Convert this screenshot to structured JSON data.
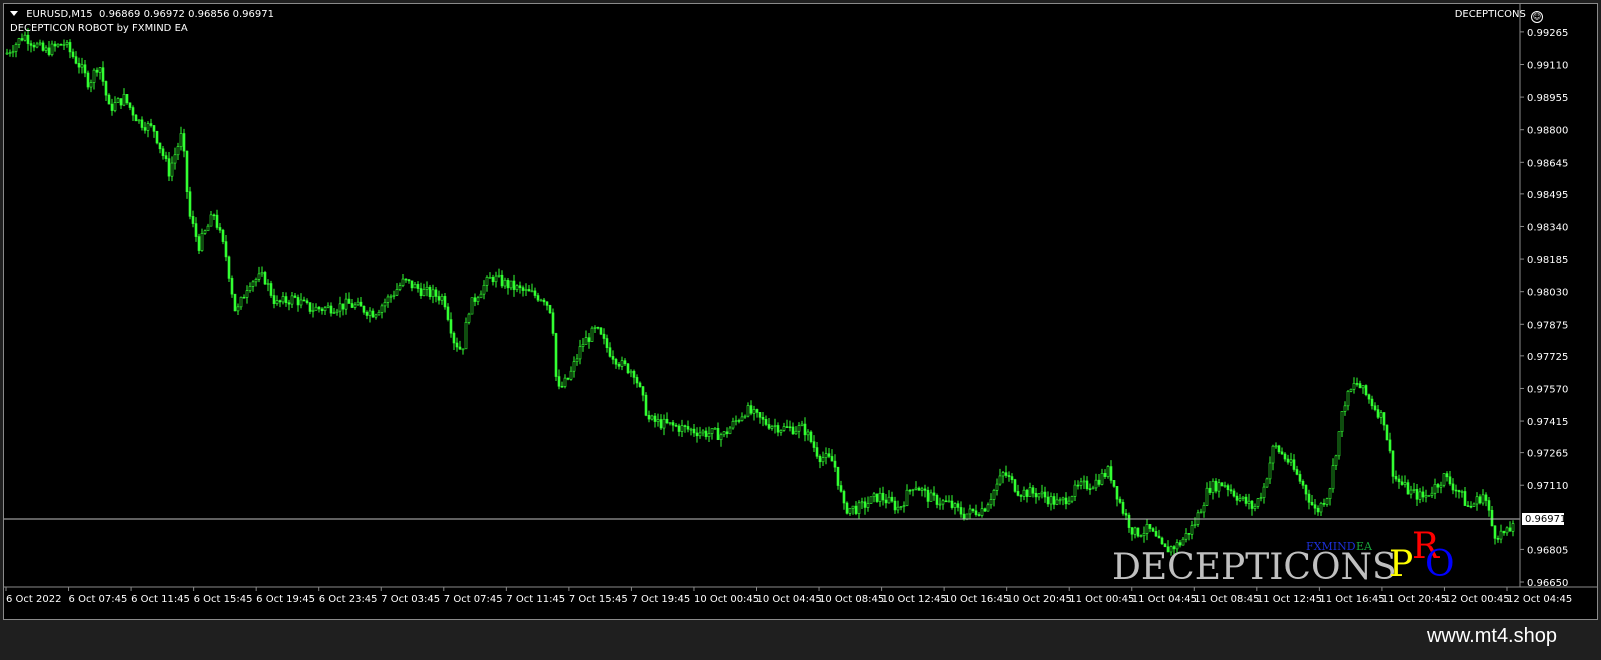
{
  "chart_header": {
    "symbol": "EURUSD,M15",
    "ohlc": "0.96869 0.96972 0.96856 0.96971",
    "robot": "DECEPTICON ROBOT by FXMIND EA",
    "corner_label": "DECEPTICONS"
  },
  "branding": {
    "decepticons": "DECEPTICONS",
    "fxmind": "FXMIND",
    "ea": "EA",
    "pro_p": "P",
    "pro_r": "R",
    "pro_o": "O",
    "watermark": "www.mt4.shop"
  },
  "colors": {
    "background": "#000000",
    "candles": "#32ff32",
    "axis_text": "#ffffff",
    "bid_line": "#c0c0c0"
  },
  "chart_data": {
    "type": "candlestick",
    "symbol": "EURUSD",
    "timeframe": "M15",
    "ylim": [
      0.9665,
      0.9935
    ],
    "y_ticks": [
      "0.99265",
      "0.99110",
      "0.98955",
      "0.98800",
      "0.98645",
      "0.98495",
      "0.98340",
      "0.98185",
      "0.98030",
      "0.97875",
      "0.97725",
      "0.97570",
      "0.97415",
      "0.97265",
      "0.97110",
      "0.96805",
      "0.96650"
    ],
    "x_ticks": [
      "6 Oct 2022",
      "6 Oct 07:45",
      "6 Oct 11:45",
      "6 Oct 15:45",
      "6 Oct 19:45",
      "6 Oct 23:45",
      "7 Oct 03:45",
      "7 Oct 07:45",
      "7 Oct 11:45",
      "7 Oct 15:45",
      "7 Oct 19:45",
      "10 Oct 00:45",
      "10 Oct 04:45",
      "10 Oct 08:45",
      "10 Oct 12:45",
      "10 Oct 16:45",
      "10 Oct 20:45",
      "11 Oct 00:45",
      "11 Oct 04:45",
      "11 Oct 08:45",
      "11 Oct 12:45",
      "11 Oct 16:45",
      "11 Oct 20:45",
      "12 Oct 00:45",
      "12 Oct 04:45"
    ],
    "current_price": "0.96971",
    "close_path": [
      [
        0,
        0.9915
      ],
      [
        20,
        0.9925
      ],
      [
        40,
        0.9917
      ],
      [
        60,
        0.9921
      ],
      [
        75,
        0.9911
      ],
      [
        85,
        0.9902
      ],
      [
        95,
        0.9912
      ],
      [
        105,
        0.989
      ],
      [
        120,
        0.9895
      ],
      [
        135,
        0.9884
      ],
      [
        150,
        0.988
      ],
      [
        165,
        0.986
      ],
      [
        178,
        0.9878
      ],
      [
        185,
        0.984
      ],
      [
        195,
        0.9825
      ],
      [
        210,
        0.984
      ],
      [
        222,
        0.982
      ],
      [
        232,
        0.9792
      ],
      [
        245,
        0.9808
      ],
      [
        260,
        0.981
      ],
      [
        272,
        0.9797
      ],
      [
        290,
        0.98
      ],
      [
        305,
        0.9795
      ],
      [
        320,
        0.9795
      ],
      [
        345,
        0.9797
      ],
      [
        370,
        0.9793
      ],
      [
        385,
        0.98
      ],
      [
        400,
        0.9808
      ],
      [
        420,
        0.9803
      ],
      [
        440,
        0.98
      ],
      [
        450,
        0.978
      ],
      [
        458,
        0.9775
      ],
      [
        465,
        0.9795
      ],
      [
        475,
        0.9803
      ],
      [
        488,
        0.981
      ],
      [
        500,
        0.9807
      ],
      [
        520,
        0.9803
      ],
      [
        540,
        0.98
      ],
      [
        548,
        0.9793
      ],
      [
        553,
        0.9755
      ],
      [
        565,
        0.9762
      ],
      [
        578,
        0.9778
      ],
      [
        592,
        0.9785
      ],
      [
        605,
        0.9775
      ],
      [
        618,
        0.9768
      ],
      [
        630,
        0.9765
      ],
      [
        645,
        0.9742
      ],
      [
        660,
        0.974
      ],
      [
        680,
        0.9738
      ],
      [
        700,
        0.9736
      ],
      [
        720,
        0.9735
      ],
      [
        742,
        0.9747
      ],
      [
        760,
        0.9741
      ],
      [
        780,
        0.9738
      ],
      [
        800,
        0.9738
      ],
      [
        815,
        0.9725
      ],
      [
        830,
        0.9722
      ],
      [
        840,
        0.97
      ],
      [
        855,
        0.97
      ],
      [
        875,
        0.9706
      ],
      [
        895,
        0.97
      ],
      [
        910,
        0.9712
      ],
      [
        925,
        0.9705
      ],
      [
        945,
        0.9702
      ],
      [
        960,
        0.9697
      ],
      [
        980,
        0.97
      ],
      [
        1000,
        0.9717
      ],
      [
        1015,
        0.9708
      ],
      [
        1035,
        0.9707
      ],
      [
        1055,
        0.9702
      ],
      [
        1075,
        0.971
      ],
      [
        1090,
        0.9712
      ],
      [
        1105,
        0.9718
      ],
      [
        1118,
        0.97
      ],
      [
        1130,
        0.9688
      ],
      [
        1145,
        0.969
      ],
      [
        1160,
        0.968
      ],
      [
        1175,
        0.9683
      ],
      [
        1190,
        0.9692
      ],
      [
        1205,
        0.971
      ],
      [
        1220,
        0.9712
      ],
      [
        1235,
        0.9705
      ],
      [
        1250,
        0.97
      ],
      [
        1260,
        0.971
      ],
      [
        1270,
        0.973
      ],
      [
        1285,
        0.9722
      ],
      [
        1300,
        0.971
      ],
      [
        1312,
        0.9698
      ],
      [
        1325,
        0.9708
      ],
      [
        1340,
        0.975
      ],
      [
        1352,
        0.976
      ],
      [
        1365,
        0.9752
      ],
      [
        1380,
        0.9742
      ],
      [
        1390,
        0.9715
      ],
      [
        1405,
        0.9708
      ],
      [
        1420,
        0.9705
      ],
      [
        1440,
        0.9715
      ],
      [
        1455,
        0.9708
      ],
      [
        1465,
        0.97
      ],
      [
        1480,
        0.9707
      ],
      [
        1490,
        0.9688
      ],
      [
        1505,
        0.9688
      ],
      [
        1511,
        0.9697
      ]
    ]
  }
}
